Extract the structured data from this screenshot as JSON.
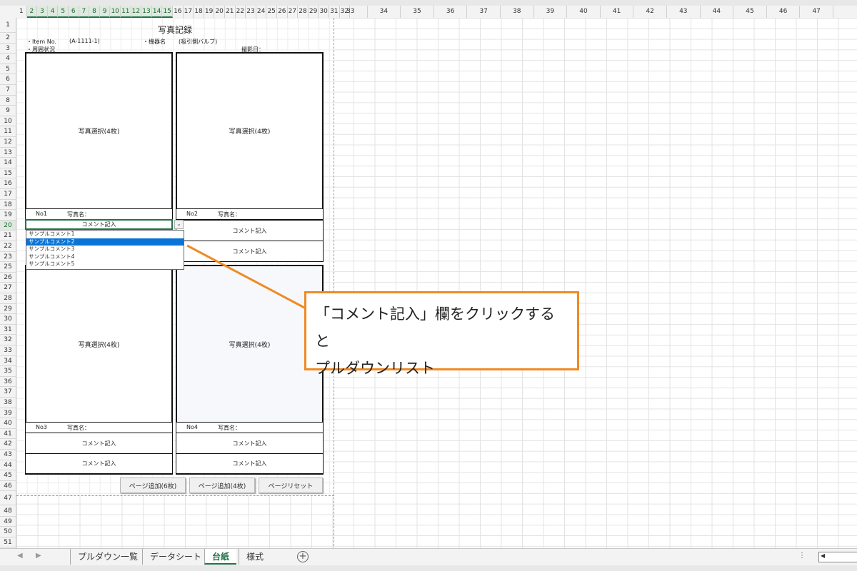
{
  "columns": {
    "narrow": [
      "1",
      "2",
      "3",
      "4",
      "5",
      "6",
      "7",
      "8",
      "9",
      "10",
      "11",
      "12",
      "13",
      "14",
      "15",
      "16",
      "17",
      "18",
      "19",
      "20",
      "21",
      "22",
      "23",
      "24",
      "25",
      "26",
      "27",
      "28",
      "29",
      "30",
      "31",
      "32"
    ],
    "wide": [
      "33",
      "34",
      "35",
      "36",
      "37",
      "38",
      "39",
      "40",
      "41",
      "42",
      "43",
      "44",
      "45",
      "46",
      "47"
    ]
  },
  "rows": [
    "1",
    "2",
    "3",
    "4",
    "5",
    "6",
    "7",
    "8",
    "9",
    "10",
    "11",
    "12",
    "13",
    "14",
    "15",
    "16",
    "17",
    "18",
    "19",
    "20",
    "21",
    "22",
    "23",
    "25",
    "26",
    "27",
    "28",
    "29",
    "30",
    "31",
    "32",
    "33",
    "34",
    "35",
    "36",
    "37",
    "38",
    "39",
    "40",
    "41",
    "42",
    "43",
    "44",
    "45",
    "46",
    "47",
    "48",
    "49",
    "50",
    "51"
  ],
  "sheet": {
    "title": "写真記録",
    "item_label": "・Item No.",
    "item_value": "(A-1111-1)",
    "equip_label": "・機器名",
    "equip_value": "(吸引側バルブ)",
    "status_label": "・周囲状況",
    "date_label": "撮影日：",
    "photo_placeholder": "写真選択(4枚)",
    "name_label": "写真名：",
    "comment_placeholder": "コメント記入",
    "no1": "No1",
    "no2": "No2",
    "no3": "No3",
    "no4": "No4"
  },
  "dropdown": {
    "cell_text": "コメント記入",
    "arrow": "⌄",
    "options": [
      "サンプルコメント1",
      "サンプルコメント2",
      "サンプルコメント3",
      "サンプルコメント4",
      "サンプルコメント5"
    ],
    "selected_index": 1
  },
  "buttons": {
    "add6": "ページ追加(6枚)",
    "add4": "ページ追加(4枚)",
    "reset": "ページリセット"
  },
  "callout": {
    "line1": "「コメント記入」欄をクリックすると",
    "line2": "プルダウンリスト",
    "border_color": "#f08a24"
  },
  "tabs": {
    "items": [
      "プルダウン一覧",
      "データシート",
      "台紙",
      "様式"
    ],
    "active_index": 2,
    "add_icon": "+"
  },
  "accent": "#217346"
}
